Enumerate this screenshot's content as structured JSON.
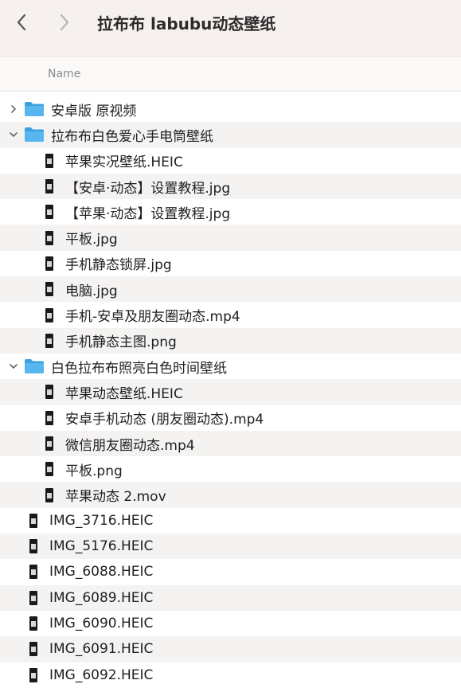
{
  "window": {
    "title": "拉布布 labubu动态壁纸",
    "back_icon": "chevron-left-icon",
    "forward_icon": "chevron-right-icon"
  },
  "columns": {
    "name": "Name"
  },
  "colors": {
    "folder": "#3aa1e0",
    "row_alt": "#f5f3f2"
  },
  "items": [
    {
      "label": "安卓版 原视频",
      "type": "folder",
      "expanded": false,
      "level": 0
    },
    {
      "label": "拉布布白色爱心手电筒壁纸",
      "type": "folder",
      "expanded": true,
      "level": 0
    },
    {
      "label": "苹果实况壁纸.HEIC",
      "type": "image",
      "level": 1
    },
    {
      "label": "【安卓·动态】设置教程.jpg",
      "type": "image",
      "level": 1
    },
    {
      "label": "【苹果·动态】设置教程.jpg",
      "type": "image",
      "level": 1
    },
    {
      "label": "平板.jpg",
      "type": "image",
      "level": 1
    },
    {
      "label": "手机静态锁屏.jpg",
      "type": "image",
      "level": 1
    },
    {
      "label": "电脑.jpg",
      "type": "image",
      "level": 1
    },
    {
      "label": "手机-安卓及朋友圈动态.mp4",
      "type": "video",
      "level": 1
    },
    {
      "label": "手机静态主图.png",
      "type": "image",
      "level": 1
    },
    {
      "label": "白色拉布布照亮白色时间壁纸",
      "type": "folder",
      "expanded": true,
      "level": 0
    },
    {
      "label": "苹果动态壁纸.HEIC",
      "type": "image",
      "level": 1
    },
    {
      "label": "安卓手机动态 (朋友圈动态).mp4",
      "type": "video",
      "level": 1
    },
    {
      "label": "微信朋友圈动态.mp4",
      "type": "video",
      "level": 1
    },
    {
      "label": "平板.png",
      "type": "image",
      "level": 1
    },
    {
      "label": "苹果动态 2.mov",
      "type": "video",
      "level": 1
    },
    {
      "label": "IMG_3716.HEIC",
      "type": "image",
      "level": 0
    },
    {
      "label": "IMG_5176.HEIC",
      "type": "image",
      "level": 0
    },
    {
      "label": "IMG_6088.HEIC",
      "type": "image",
      "level": 0
    },
    {
      "label": "IMG_6089.HEIC",
      "type": "image",
      "level": 0
    },
    {
      "label": "IMG_6090.HEIC",
      "type": "image",
      "level": 0
    },
    {
      "label": "IMG_6091.HEIC",
      "type": "image",
      "level": 0
    },
    {
      "label": "IMG_6092.HEIC",
      "type": "image",
      "level": 0
    }
  ]
}
